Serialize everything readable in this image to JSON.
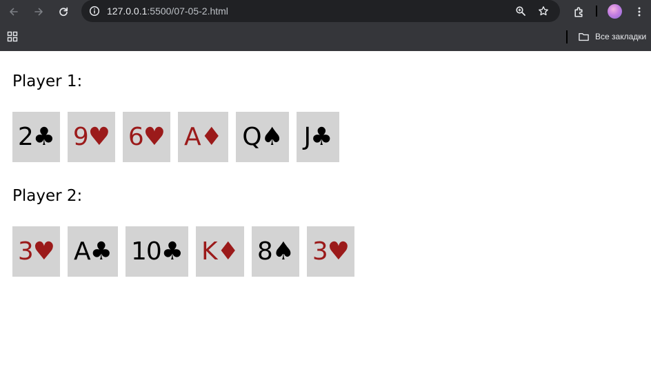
{
  "browser": {
    "url_host": "127.0.0.1",
    "url_path": ":5500/07-05-2.html",
    "bookmarks_folder": "Все закладки"
  },
  "players": [
    {
      "label": "Player 1:",
      "cards": [
        {
          "text": "2♣",
          "color": "black"
        },
        {
          "text": "9♥",
          "color": "red"
        },
        {
          "text": "6♥",
          "color": "red"
        },
        {
          "text": "A♦",
          "color": "red"
        },
        {
          "text": "Q♠",
          "color": "black"
        },
        {
          "text": "J♣",
          "color": "black"
        }
      ]
    },
    {
      "label": "Player 2:",
      "cards": [
        {
          "text": "3♥",
          "color": "red"
        },
        {
          "text": "A♣",
          "color": "black"
        },
        {
          "text": "10♣",
          "color": "black"
        },
        {
          "text": "K♦",
          "color": "red"
        },
        {
          "text": "8♠",
          "color": "black"
        },
        {
          "text": "3♥",
          "color": "red"
        }
      ]
    }
  ],
  "colors": {
    "red_suit": "#9b1a1a",
    "black_suit": "#000000",
    "card_background": "#d3d3d3"
  }
}
